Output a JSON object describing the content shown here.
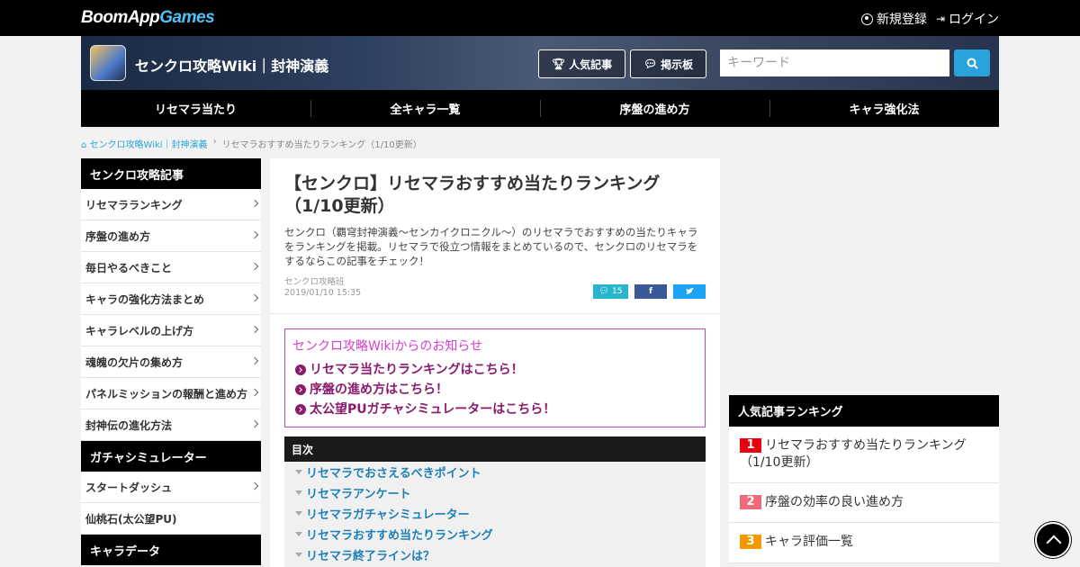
{
  "topbar": {
    "logo_boom": "BoomApp",
    "logo_games": "Games",
    "signup": "新規登録",
    "login": "ログイン"
  },
  "header": {
    "site_title": "センクロ攻略Wiki｜封神演義",
    "popular_button": "人気記事",
    "board_button": "掲示板",
    "search_placeholder": "キーワード"
  },
  "nav": {
    "items": [
      "リセマラ当たり",
      "全キャラ一覧",
      "序盤の進め方",
      "キャラ強化法"
    ]
  },
  "breadcrumb": {
    "home": "センクロ攻略Wiki｜封神演義",
    "current": "リセマラおすすめ当たりランキング（1/10更新）"
  },
  "sidebar": {
    "sections": [
      {
        "title": "センクロ攻略記事",
        "items": [
          "リセマラランキング",
          "序盤の進め方",
          "毎日やるべきこと",
          "キャラの強化方法まとめ",
          "キャラレベルの上げ方",
          "魂魄の欠片の集め方",
          "パネルミッションの報酬と進め方",
          "封神伝の進化方法"
        ]
      },
      {
        "title": "ガチャシミュレーター",
        "items": [
          "スタートダッシュ",
          "仙桃石(太公望PU)"
        ]
      },
      {
        "title": "キャラデータ",
        "items": []
      }
    ]
  },
  "article": {
    "title": "【センクロ】リセマラおすすめ当たりランキング（1/10更新）",
    "description": "センクロ（覇穹封神演義～センカイクロニクル～）のリセマラでおすすめの当たりキャラをランキングを掲載。リセマラで役立つ情報をまとめているので、センクロのリセマラをするならこの記事をチェック！",
    "author": "センクロ攻略班",
    "date": "2019/01/10 15:35",
    "comment_count": "15",
    "notice": {
      "title": "センクロ攻略Wikiからのお知らせ",
      "links": [
        "リセマラ当たりランキングはこちら！",
        "序盤の進め方はこちら！",
        "太公望PUガチャシミュレーターはこちら！"
      ]
    },
    "toc": {
      "title": "目次",
      "items": [
        "リセマラでおさえるべきポイント",
        "リセマラアンケート",
        "リセマラガチャシミュレーター",
        "リセマラおすすめ当たりランキング",
        "リセマラ終了ラインは？"
      ]
    }
  },
  "ranking": {
    "title": "人気記事ランキング",
    "items": [
      {
        "rank": "1",
        "label": "リセマラおすすめ当たりランキング（1/10更新）"
      },
      {
        "rank": "2",
        "label": "序盤の効率の良い進め方"
      },
      {
        "rank": "3",
        "label": "キャラ評価一覧"
      }
    ]
  }
}
